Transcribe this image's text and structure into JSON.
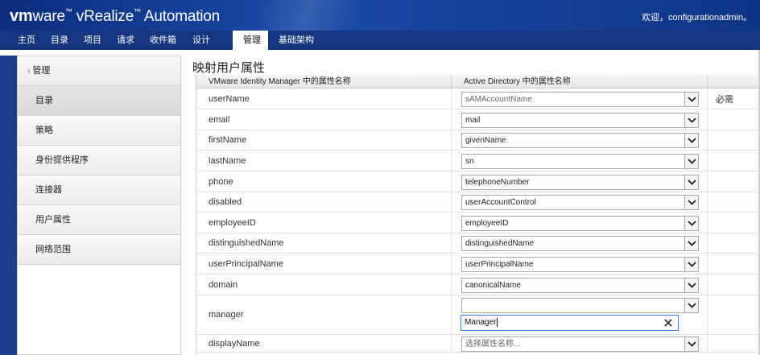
{
  "header": {
    "brand_vm": "vm",
    "brand_ware": "ware",
    "brand_product": "vRealize",
    "brand_suffix": "Automation",
    "greeting": "欢迎，configurationadmin。"
  },
  "nav": {
    "tabs": [
      {
        "label": "主页"
      },
      {
        "label": "目录"
      },
      {
        "label": "项目"
      },
      {
        "label": "请求"
      },
      {
        "label": "收件箱"
      },
      {
        "label": "设计"
      },
      {
        "label": "管理"
      },
      {
        "label": "基础架构"
      }
    ],
    "active": "管理"
  },
  "sidebar": {
    "back_label": "管理",
    "items": [
      {
        "label": "目录"
      },
      {
        "label": "策略"
      },
      {
        "label": "身份提供程序"
      },
      {
        "label": "连接器"
      },
      {
        "label": "用户属性"
      },
      {
        "label": "网络范围"
      }
    ],
    "active": "目录"
  },
  "page": {
    "title": "映射用户属性",
    "col_vidm": "VMware Identity Manager 中的属性名称",
    "col_ad": "Active Directory 中的属性名称",
    "col_req": "",
    "required_label": "必需",
    "rows": [
      {
        "name": "userName",
        "ad": "sAMAccountName",
        "required": true,
        "muted": true
      },
      {
        "name": "email",
        "ad": "mail",
        "required": false
      },
      {
        "name": "firstName",
        "ad": "givenName",
        "required": false
      },
      {
        "name": "lastName",
        "ad": "sn",
        "required": false
      },
      {
        "name": "phone",
        "ad": "telephoneNumber",
        "required": false
      },
      {
        "name": "disabled",
        "ad": "userAccountControl",
        "required": false
      },
      {
        "name": "employeeID",
        "ad": "employeeID",
        "required": false
      },
      {
        "name": "distinguishedName",
        "ad": "distinguishedName",
        "required": false
      },
      {
        "name": "userPrincipalName",
        "ad": "userPrincipalName",
        "required": false
      },
      {
        "name": "domain",
        "ad": "canonicalName",
        "required": false
      },
      {
        "name": "manager",
        "ad": "",
        "required": false,
        "search_value": "Manager"
      },
      {
        "name": "displayName",
        "ad": "选择属性名称...",
        "required": false,
        "muted": true
      }
    ]
  },
  "icons": {
    "dropdown": "chevron-down-icon",
    "clear": "close-icon",
    "back": "chevron-left-icon"
  }
}
